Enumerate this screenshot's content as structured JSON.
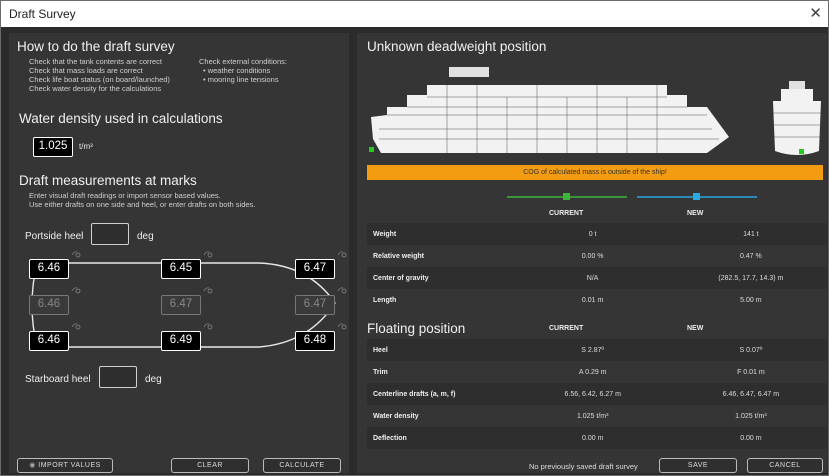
{
  "window": {
    "title": "Draft Survey"
  },
  "howto": {
    "heading": "How to do the draft survey",
    "steps_left": [
      "Check that the tank contents are correct",
      "Check that mass loads are correct",
      "Check life boat status (on board/launched)",
      "Check water density for the calculations"
    ],
    "steps_right_title": "Check external conditions:",
    "steps_right": [
      "• weather conditions",
      "• mooring line tensions"
    ]
  },
  "density": {
    "heading": "Water density used in calculations",
    "value": "1.025",
    "unit": "t/m³"
  },
  "marks": {
    "heading": "Draft measurements at marks",
    "instructions": [
      "Enter visual draft readings or import sensor based values.",
      "Use either drafts on one side and heel, or enter drafts on both sides."
    ],
    "portside_label": "Portside heel",
    "portside_unit": "deg",
    "starboard_label": "Starboard heel",
    "starboard_unit": "deg",
    "top": [
      "6.46",
      "6.45",
      "6.47"
    ],
    "center": [
      "6.46",
      "6.47",
      "6.47"
    ],
    "bottom": [
      "6.46",
      "6.49",
      "6.48"
    ]
  },
  "buttons": {
    "import": "IMPORT VALUES",
    "clear": "CLEAR",
    "calculate": "CALCULATE",
    "save": "SAVE",
    "cancel": "CANCEL"
  },
  "deadweight": {
    "heading": "Unknown deadweight position",
    "warning": "COG of calculated mass is outside of the ship!",
    "col_current": "CURRENT",
    "col_new": "NEW",
    "current_color": "#3cb53c",
    "new_color": "#2aa8e0",
    "rows": [
      {
        "k": "Weight",
        "cur": "0 t",
        "new": "141 t"
      },
      {
        "k": "Relative weight",
        "cur": "0.00 %",
        "new": "0.47 %"
      },
      {
        "k": "Center of gravity",
        "cur": "N/A",
        "new": "(282.5, 17.7, 14.3) m"
      },
      {
        "k": "Length",
        "cur": "0.01 m",
        "new": "5.00 m"
      }
    ]
  },
  "floating": {
    "heading": "Floating position",
    "col_current": "CURRENT",
    "col_new": "NEW",
    "rows": [
      {
        "k": "Heel",
        "cur": "S 2.87º",
        "new": "S 0.07º"
      },
      {
        "k": "Trim",
        "cur": "A 0.29 m",
        "new": "F 0.01 m"
      },
      {
        "k": "Centerline drafts (a, m, f)",
        "cur": "6.56, 6.42, 6.27 m",
        "new": "6.46, 6.47, 6.47 m"
      },
      {
        "k": "Water density",
        "cur": "1.025 t/m³",
        "new": "1.025 t/m³"
      },
      {
        "k": "Deflection",
        "cur": "0.00 m",
        "new": "0.00 m"
      }
    ]
  },
  "status": {
    "saved_note": "No previously saved draft survey"
  },
  "colors": {
    "warning": "#f39c12",
    "marker": "#22cc22"
  }
}
